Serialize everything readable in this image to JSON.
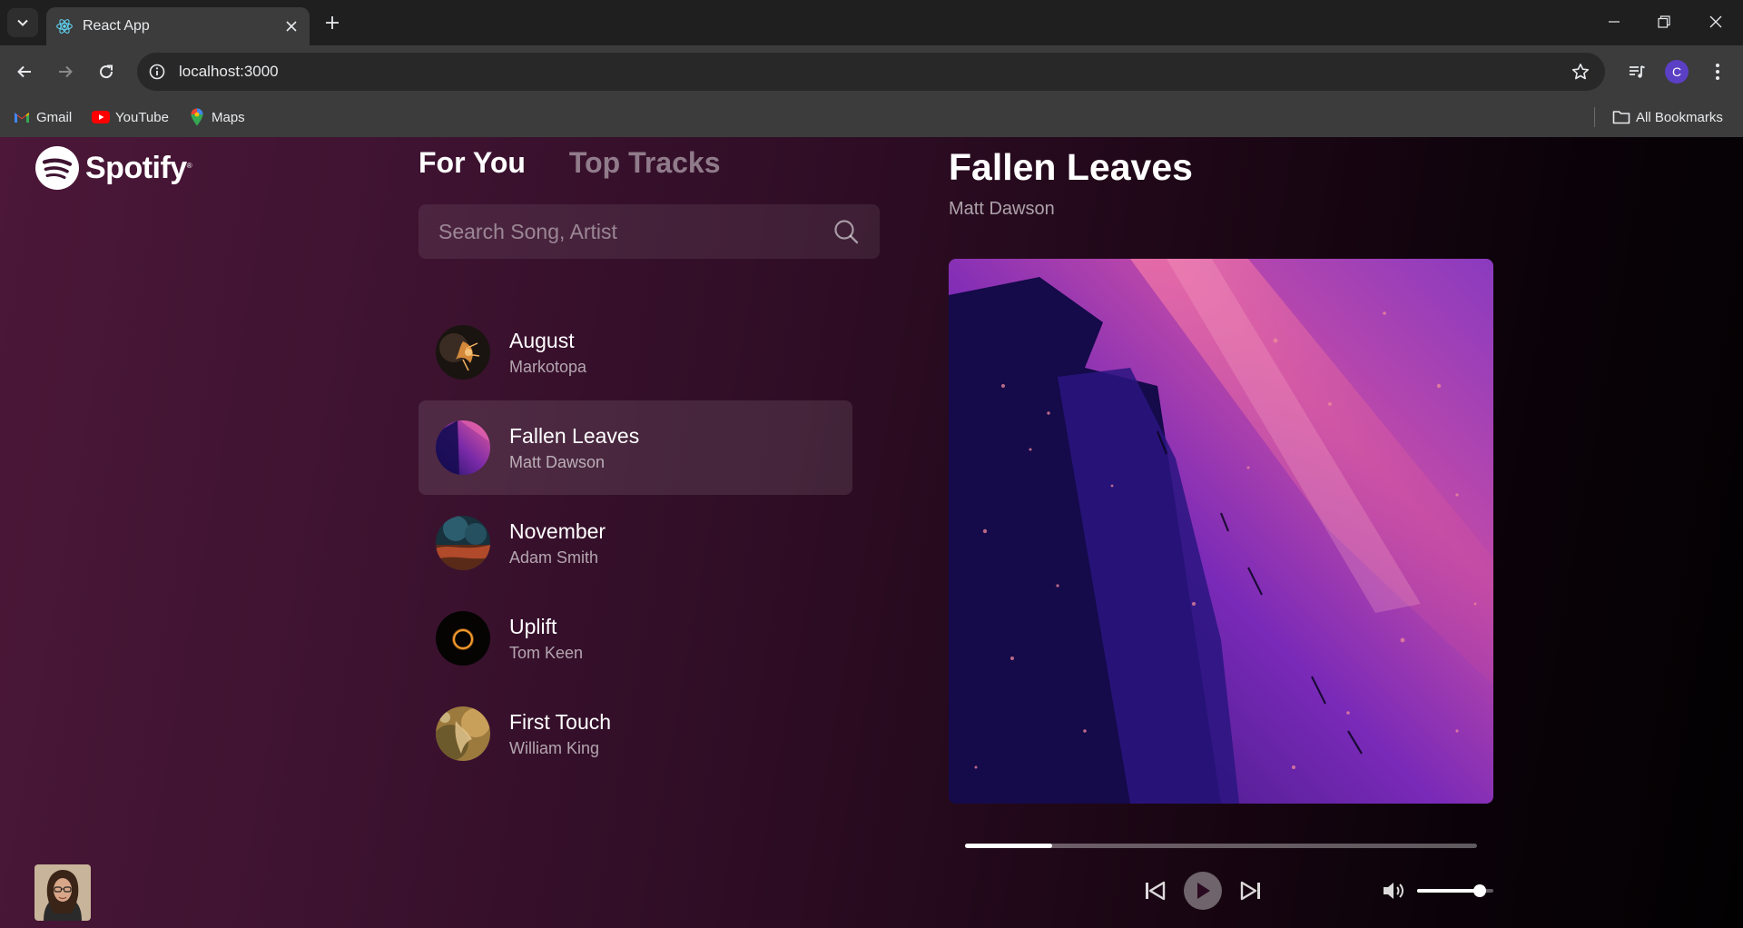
{
  "browser": {
    "tab_title": "React App",
    "url": "localhost:3000",
    "profile_initial": "C",
    "bookmarks": [
      {
        "label": "Gmail",
        "icon": "gmail-icon"
      },
      {
        "label": "YouTube",
        "icon": "youtube-icon"
      },
      {
        "label": "Maps",
        "icon": "maps-icon"
      }
    ],
    "all_bookmarks_label": "All Bookmarks"
  },
  "app": {
    "logo_text": "Spotify",
    "logo_mark": "®",
    "tabs": [
      {
        "label": "For You",
        "active": true
      },
      {
        "label": "Top Tracks",
        "active": false
      }
    ],
    "search": {
      "placeholder": "Search Song, Artist",
      "value": ""
    },
    "songs": [
      {
        "title": "August",
        "artist": "Markotopa",
        "selected": false
      },
      {
        "title": "Fallen Leaves",
        "artist": "Matt Dawson",
        "selected": true
      },
      {
        "title": "November",
        "artist": "Adam Smith",
        "selected": false
      },
      {
        "title": "Uplift",
        "artist": "Tom Keen",
        "selected": false
      },
      {
        "title": "First Touch",
        "artist": "William King",
        "selected": false
      }
    ],
    "now_playing": {
      "title": "Fallen Leaves",
      "artist": "Matt Dawson",
      "progress_fraction": 0.17,
      "volume_fraction": 0.82
    },
    "colors": {
      "accent_green": "#1db954",
      "background_start": "#4c1738",
      "background_end": "#020102"
    }
  }
}
